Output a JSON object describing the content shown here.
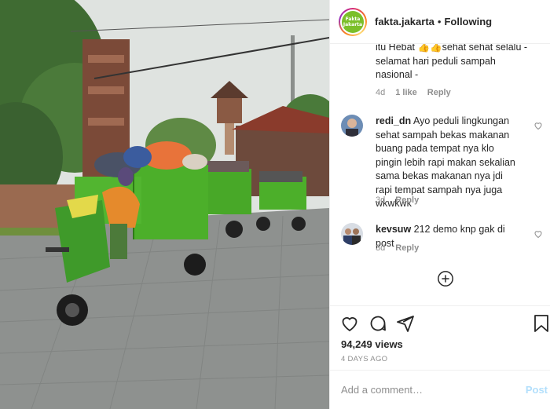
{
  "header": {
    "username": "fakta.jakarta",
    "separator": "•",
    "follow_status": "Following",
    "avatar_text_line1": "Fakta",
    "avatar_text_line2": "Jakarta"
  },
  "comments": [
    {
      "username": "",
      "text_partial_line1": "itu Hebat 👍👍sehat sehat selalu -",
      "text_partial_line2": "selamat hari peduli sampah",
      "text_partial_line3": "nasional -",
      "time": "4d",
      "likes": "1 like",
      "reply": "Reply"
    },
    {
      "username": "redi_dn",
      "text": "Ayo peduli lingkungan sehat sampah bekas makanan buang pada tempat nya klo pingin lebih rapi makan sekalian sama bekas makanan nya jdi rapi tempat sampah nya juga wkwkwk",
      "time": "3d",
      "reply": "Reply"
    },
    {
      "username": "kevsuw",
      "text": "212 demo knp gak di post",
      "time": "3d",
      "reply": "Reply"
    }
  ],
  "icons": {
    "like": "heart-icon",
    "comment": "comment-icon",
    "share": "share-icon",
    "save": "bookmark-icon",
    "more_comments": "plus-circle-icon"
  },
  "stats": {
    "views": "94,249 views",
    "date": "4 DAYS AGO"
  },
  "add_comment": {
    "placeholder": "Add a comment…",
    "post_label": "Post"
  },
  "colors": {
    "border": "#efefef",
    "muted": "#8e8e8e",
    "post_disabled": "#b2dffc",
    "cart_green": "#4caf2a"
  }
}
